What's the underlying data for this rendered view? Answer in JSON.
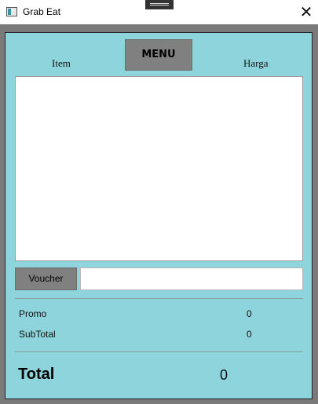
{
  "window": {
    "title": "Grab Eat",
    "icon": "app-window-icon",
    "close_icon": "close-icon",
    "close_glyph": "✕"
  },
  "header": {
    "item_label": "Item",
    "menu_button": "MENU",
    "harga_label": "Harga"
  },
  "order_list": {
    "items": []
  },
  "voucher": {
    "button_label": "Voucher",
    "input_value": "",
    "input_placeholder": ""
  },
  "summary": {
    "promo_label": "Promo",
    "promo_value": "0",
    "subtotal_label": "SubTotal",
    "subtotal_value": "0",
    "total_label": "Total",
    "total_value": "0"
  },
  "colors": {
    "panel_background": "#8ed4dc",
    "button_gray": "#808080",
    "frame_gray": "#7a7a7a"
  }
}
